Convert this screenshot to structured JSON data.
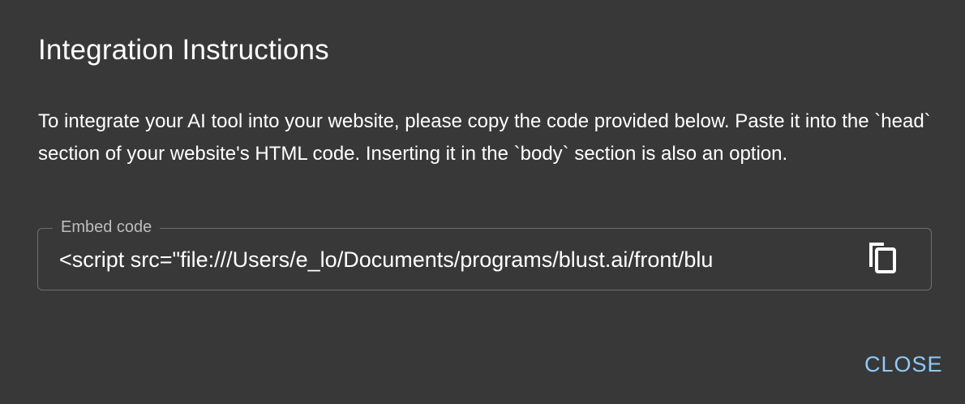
{
  "dialog": {
    "title": "Integration Instructions",
    "description": "To integrate your AI tool into your website, please copy the code provided below. Paste it into the `head` section of your website's HTML code. Inserting it in the `body` section is also an option.",
    "embed": {
      "label": "Embed code",
      "value": "<script src=\"file:///Users/e_lo/Documents/programs/blust.ai/front/blu",
      "copy_icon": "copy-icon"
    },
    "close_label": "CLOSE",
    "colors": {
      "background": "#383838",
      "accent": "#90caf9",
      "text": "#ffffff",
      "muted": "#bdbdbd",
      "border": "#6e6e6e"
    }
  }
}
